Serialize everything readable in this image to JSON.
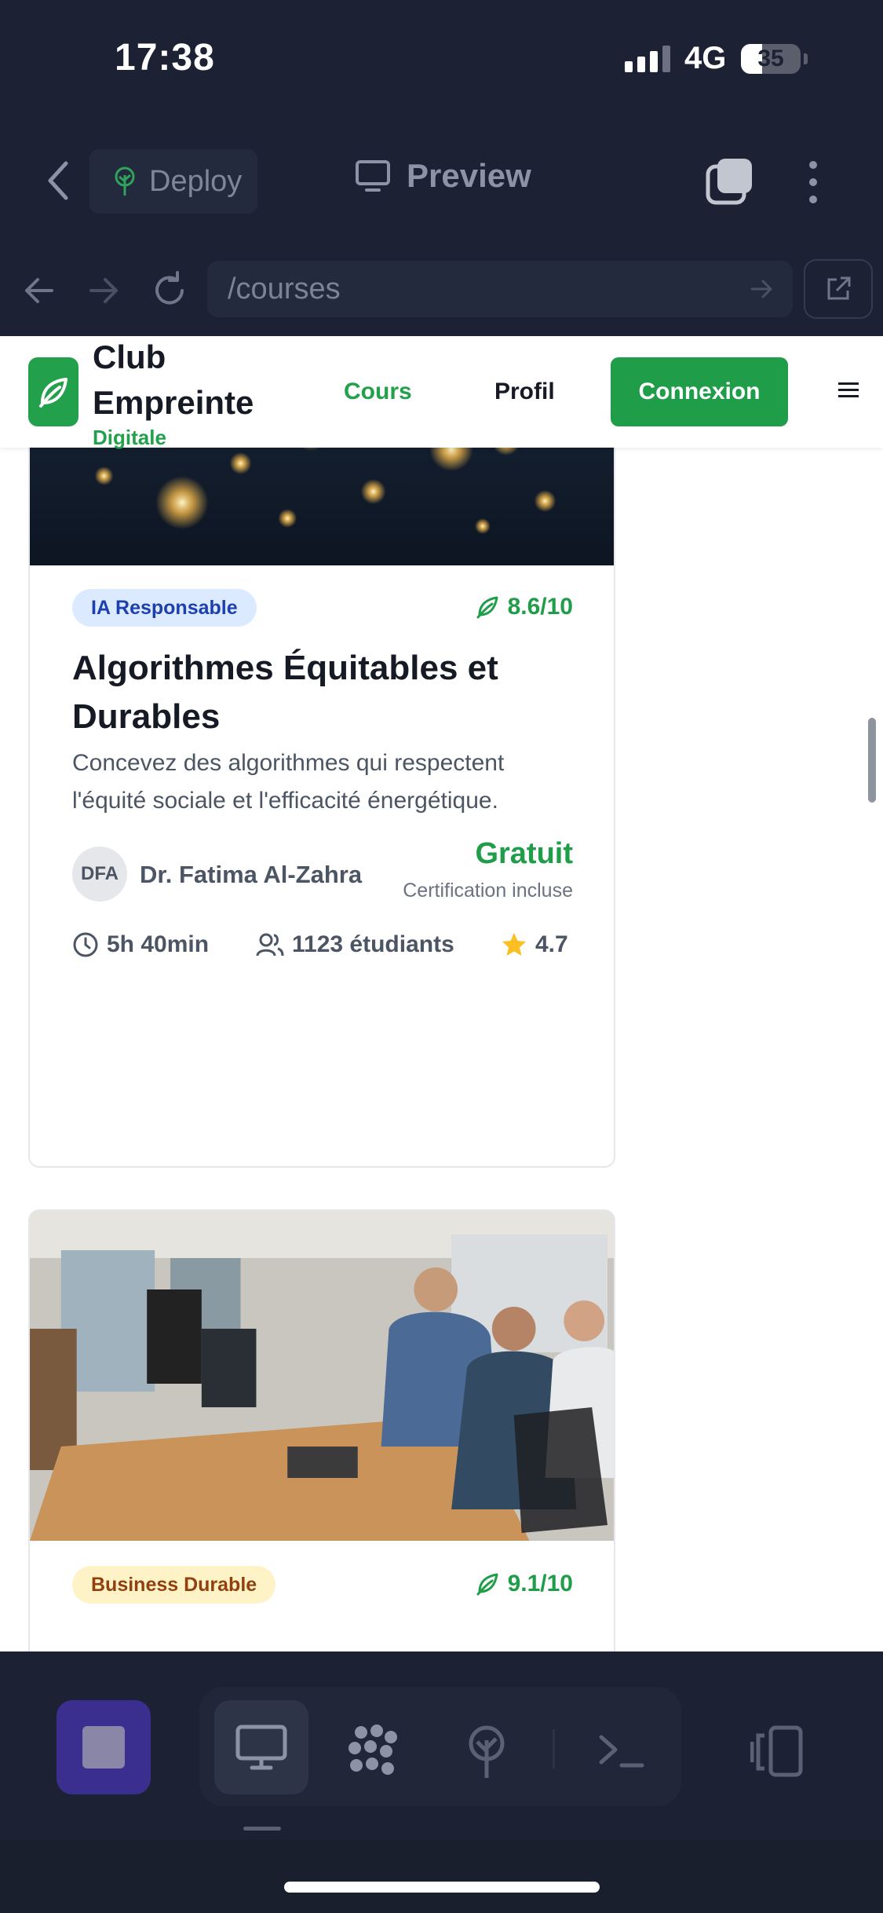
{
  "status_bar": {
    "time": "17:38",
    "network": "4G",
    "battery": "35",
    "battery_level": 0.35
  },
  "toolbar": {
    "deploy_label": "Deploy",
    "preview_label": "Preview"
  },
  "url_bar": {
    "path": "/courses"
  },
  "site": {
    "brand_line1": "Club",
    "brand_line2": "Empreinte",
    "brand_line3": "Digitale",
    "nav": {
      "courses": "Cours",
      "profile": "Profil",
      "login": "Connexion"
    }
  },
  "courses": [
    {
      "badge": "IA Responsable",
      "badge_bg": "#dbeafe",
      "badge_color": "#1e40af",
      "score": "8.6/10",
      "title": "Algorithmes Équitables et Durables",
      "description": "Concevez des algorithmes qui respectent l'équité sociale et l'efficacité énergétique.",
      "author_initials": "DFA",
      "author": "Dr. Fatima Al-Zahra",
      "price": "Gratuit",
      "certification": "Certification incluse",
      "duration": "5h 40min",
      "students": "1123 étudiants",
      "rating": "4.7"
    },
    {
      "badge": "Business Durable",
      "badge_bg": "#fef3c7",
      "badge_color": "#92400e",
      "score": "9.1/10"
    }
  ],
  "colors": {
    "brand_green": "#1f9d49",
    "dark_bg": "#1c2133"
  }
}
